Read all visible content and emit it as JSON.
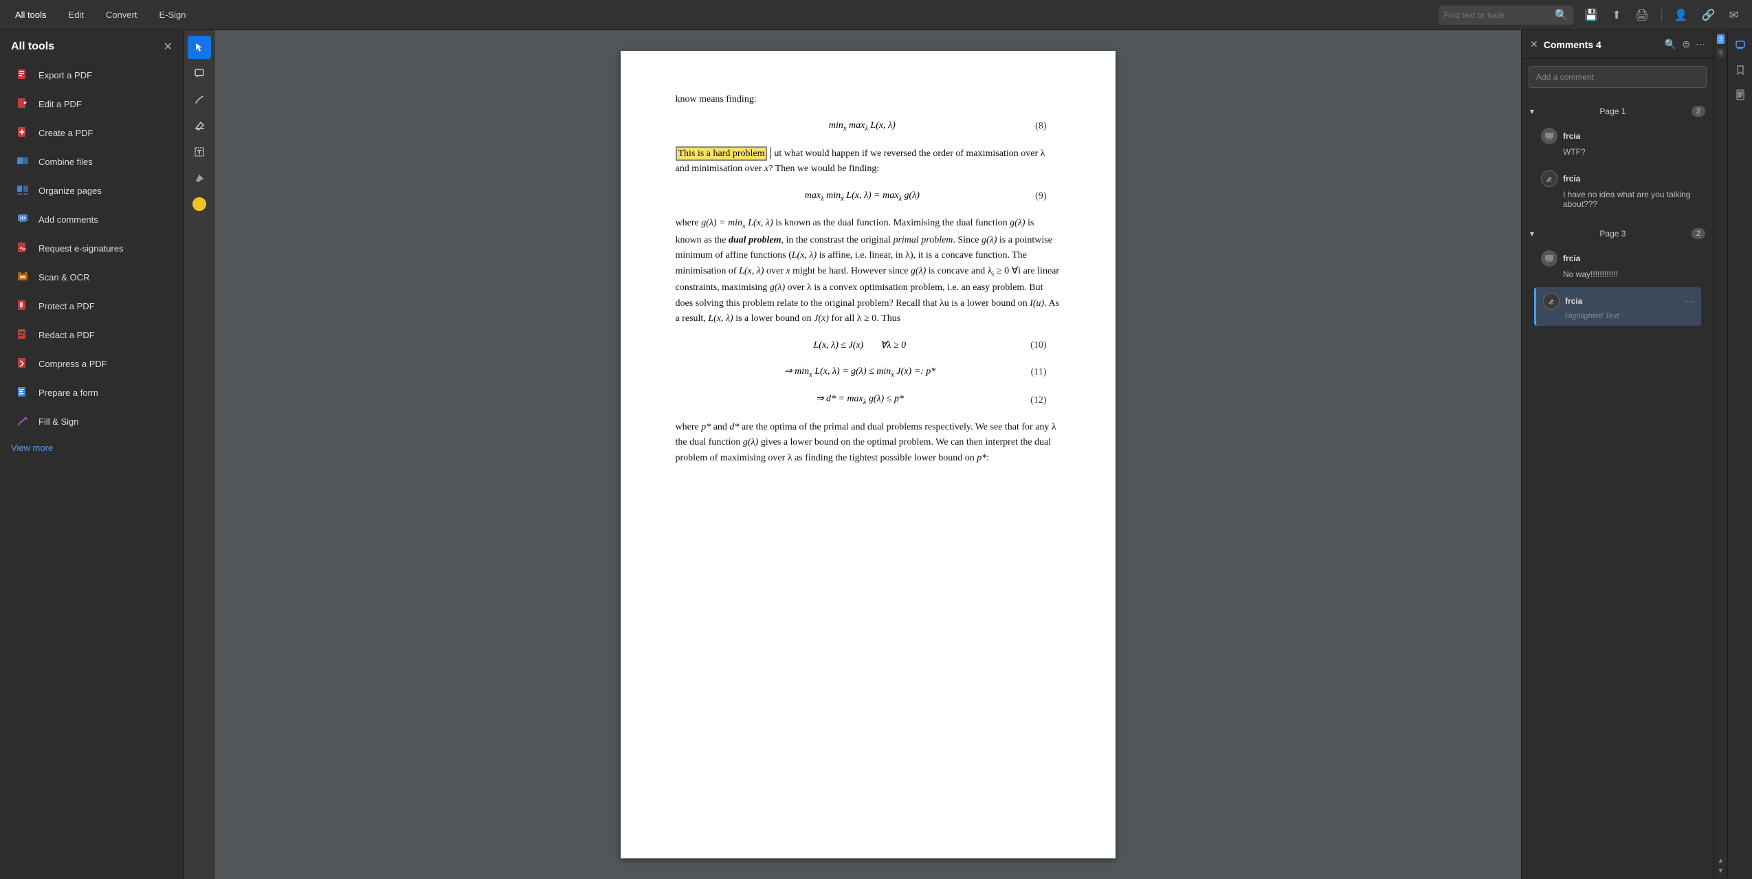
{
  "topbar": {
    "nav_items": [
      {
        "id": "all-tools",
        "label": "All tools",
        "active": true
      },
      {
        "id": "edit",
        "label": "Edit",
        "active": false
      },
      {
        "id": "convert",
        "label": "Convert",
        "active": false
      },
      {
        "id": "esign",
        "label": "E-Sign",
        "active": false
      }
    ],
    "search_placeholder": "Find text or tools",
    "icons": [
      "save",
      "upload",
      "print",
      "account",
      "link",
      "mail"
    ]
  },
  "sidebar": {
    "title": "All tools",
    "items": [
      {
        "id": "export-pdf",
        "label": "Export a PDF",
        "color": "#e34040"
      },
      {
        "id": "edit-pdf",
        "label": "Edit a PDF",
        "color": "#e34040"
      },
      {
        "id": "create-pdf",
        "label": "Create a PDF",
        "color": "#e34040"
      },
      {
        "id": "combine-files",
        "label": "Combine files",
        "color": "#4a9eff"
      },
      {
        "id": "organize-pages",
        "label": "Organize pages",
        "color": "#4a9eff"
      },
      {
        "id": "add-comments",
        "label": "Add comments",
        "color": "#4a9eff"
      },
      {
        "id": "request-esig",
        "label": "Request e-signatures",
        "color": "#e34040"
      },
      {
        "id": "scan-ocr",
        "label": "Scan & OCR",
        "color": "#e07000"
      },
      {
        "id": "protect-pdf",
        "label": "Protect a PDF",
        "color": "#e34040"
      },
      {
        "id": "redact-pdf",
        "label": "Redact a PDF",
        "color": "#e34040"
      },
      {
        "id": "compress-pdf",
        "label": "Compress a PDF",
        "color": "#e34040"
      },
      {
        "id": "prepare-form",
        "label": "Prepare a form",
        "color": "#4a9eff"
      },
      {
        "id": "fill-sign",
        "label": "Fill & Sign",
        "color": "#9b59b6"
      }
    ],
    "view_more": "View more"
  },
  "comments": {
    "title": "Comments",
    "count": "4",
    "add_placeholder": "Add a comment",
    "pages": [
      {
        "label": "Page 1",
        "count": "2",
        "items": [
          {
            "author": "frcia",
            "text": "WTF?",
            "type": "speech"
          },
          {
            "author": "frcia",
            "text": "I have no idea what are you talking about???",
            "type": "edit"
          }
        ]
      },
      {
        "label": "Page 3",
        "count": "2",
        "items": [
          {
            "author": "frcia",
            "text": "No way!!!!!!!!!!!!",
            "type": "speech"
          },
          {
            "author": "frcia",
            "text": "Highlighted Text",
            "type": "edit",
            "highlighted": true
          }
        ]
      }
    ]
  },
  "pdf": {
    "intro_text": "know means finding:",
    "eq8_label": "(8)",
    "eq9_label": "(9)",
    "eq10_label": "(10)",
    "eq11_label": "(11)",
    "eq12_label": "(12)",
    "highlighted_text": "This is a hard problem",
    "paragraph1": "ut what would happen if we reversed the order of maximisation over λ and minimisation over x? Then we would be finding:",
    "paragraph2": "where g(λ) = min",
    "paragraph3": "x",
    "paragraph4": "L(x, λ) is known as the dual function. Maximising the dual function g(λ) is known as the dual problem, in the constrast the original primal problem. Since g(λ) is a pointwise minimum of affine functions (L(x, λ) is affine, i.e. linear, in λ), it is a concave function. The minimisation of L(x, λ) over x might be hard. However since g(λ) is concave and λ",
    "paragraph5": "i",
    "paragraph6": "≥ 0 ∀i are linear constraints, maximising g(λ) over λ is a convex optimisation problem, i.e. an easy problem. But does solving this problem relate to the original problem? Recall that λu is a lower bound on I(u). As a result, L(x, λ) is a lower bound on J(x) for all λ ≥ 0. Thus",
    "paragraph7": "where p* and d* are the optima of the primal and dual problems respectively. We see that for any λ the dual function g(λ) gives a lower bound on the optimal problem. We can then interpret the dual problem of maximising over λ as finding the tightest possible lower bound on p*:"
  },
  "scroll_nums": [
    "3",
    "5"
  ],
  "colors": {
    "accent_blue": "#4a9eff",
    "sidebar_bg": "#2d2d2d",
    "toolbar_bg": "#323232",
    "highlight_yellow": "#ffe066"
  }
}
